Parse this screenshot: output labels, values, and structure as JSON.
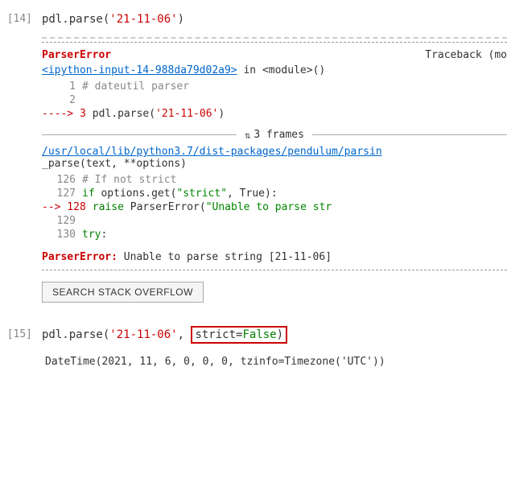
{
  "cells": {
    "cell14": {
      "number": "[14]",
      "input": "pdl.parse(",
      "input_string": "'21-11-06'",
      "input_close": ")"
    },
    "cell15": {
      "number": "[15]",
      "input_pre": "pdl.parse(",
      "input_string": "'21-11-06'",
      "input_mid": ", ",
      "input_highlight_pre": "strict=",
      "input_highlight_kw": "False",
      "input_close": ")",
      "output": "DateTime(2021, 11, 6, 0, 0, 0, tzinfo=Timezone('UTC'))"
    }
  },
  "error": {
    "parser_error_label": "ParserError",
    "traceback_label": "Traceback (mo",
    "link_text": "<ipython-input-14-988da79d02a9>",
    "in_text": " in ",
    "module_text": "<module>()",
    "line1_num": "1",
    "line1_comment": "# dateutil parser",
    "line2_num": "2",
    "arrow_line_num": "----> 3",
    "arrow_line_code": "pdl.parse(",
    "arrow_line_str": "'21-11-06'",
    "arrow_line_close": ")",
    "frames_text": "3 frames",
    "path_text": "/usr/local/lib/python3.7/dist-packages/pendulum/parsin",
    "path_text2": "_parse(text, **options)",
    "line126_num": "126",
    "line126_code": "    ",
    "line126_comment": "# If not strict",
    "line127_num": "127",
    "line127_code": "        if options.get(",
    "line127_str": "\"strict\"",
    "line127_rest": ", True):",
    "arrow128_num": "--> 128",
    "arrow128_code": "            raise ParserError(",
    "arrow128_str": "\"Unable to parse str",
    "line129_num": "129",
    "line130_num": "130",
    "line130_code": "        ",
    "line130_kw": "try",
    "line130_colon": ":",
    "error_label": "ParserError:",
    "error_text": " Unable to parse string [21-11-06]",
    "so_button": "SEARCH STACK OVERFLOW"
  }
}
